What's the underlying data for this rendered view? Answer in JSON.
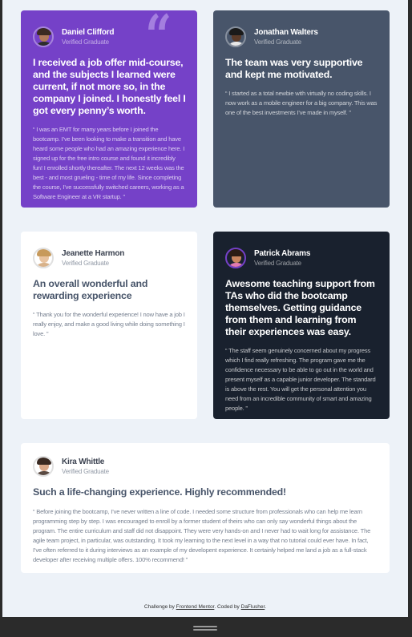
{
  "testimonials": [
    {
      "name": "Daniel Clifford",
      "role": "Verified Graduate",
      "headline": "I received a job offer mid-course, and the subjects I learned were current, if not more so, in the company I joined. I honestly feel I got every penny’s worth.",
      "body": "“ I was an EMT for many years before I joined the bootcamp. I’ve been looking to make a transition and have heard some people who had an amazing experience here. I signed up for the free intro course and found it incredibly fun! I enrolled shortly thereafter. The next 12 weeks was the best - and most grueling - time of my life. Since completing the course, I’ve successfully switched careers, working as a Software Engineer at a VR startup. ”",
      "avatar_colors": {
        "hair": "#3b2a22",
        "face": "#b07a5a",
        "shirt": "#2d2d2d"
      }
    },
    {
      "name": "Jonathan Walters",
      "role": "Verified Graduate",
      "headline": "The team was very supportive and kept me motivated.",
      "body": "“ I started as a total newbie with virtually no coding skills. I now work as a mobile engineer for a big company. This was one of the best investments I’ve made in myself. ”",
      "avatar_colors": {
        "hair": "#1a1a1a",
        "face": "#5a3a28",
        "shirt": "#e8e8e8"
      }
    },
    {
      "name": "Jeanette Harmon",
      "role": "Verified Graduate",
      "headline": "An overall wonderful and rewarding experience",
      "body": "“ Thank you for the wonderful experience! I now have a job I really enjoy, and make a good living while doing something I love. ”",
      "avatar_colors": {
        "hair": "#c79a5c",
        "face": "#e8c3a0",
        "shirt": "#d8b28a"
      }
    },
    {
      "name": "Patrick Abrams",
      "role": "Verified Graduate",
      "headline": "Awesome teaching support from TAs who did the bootcamp themselves. Getting guidance from them and learning from their experiences was easy.",
      "body": "“ The staff seem genuinely concerned about my progress which I find really refreshing. The program gave me the confidence necessary to be able to go out in the world and present myself as a capable junior developer. The standard is above the rest. You will get the personal attention you need from an incredible community of smart and amazing people. ”",
      "avatar_colors": {
        "hair": "#2b1c14",
        "face": "#c8845e",
        "shirt": "#e07ab0"
      }
    },
    {
      "name": "Kira Whittle",
      "role": "Verified Graduate",
      "headline": "Such a life-changing experience. Highly recommended!",
      "body": "“ Before joining the bootcamp, I’ve never written a line of code. I needed some structure from professionals who can help me learn programming step by step. I was encouraged to enroll by a former student of theirs who can only say wonderful things about the program. The entire curriculum and staff did not disappoint. They were very hands-on and I never had to wait long for assistance. The agile team project, in particular, was outstanding. It took my learning to the next level in a way that no tutorial could ever have. In fact, I’ve often referred to it during interviews as an example of my developent experience. It certainly helped me land a job as a full-stack developer after receiving multiple offers. 100% recommend! ”",
      "avatar_colors": {
        "hair": "#3a2a22",
        "face": "#d9a98a",
        "shirt": "#5a4a42"
      }
    }
  ],
  "footer": {
    "prefix": "Challenge by ",
    "link1": "Frontend Mentor",
    "middle": ". Coded by ",
    "link2": "DaFlusher",
    "suffix": "."
  },
  "colors": {
    "purple": "#7541c8",
    "slate": "#48556a",
    "dark": "#19212e",
    "white": "#ffffff",
    "background": "#edf2f8"
  }
}
